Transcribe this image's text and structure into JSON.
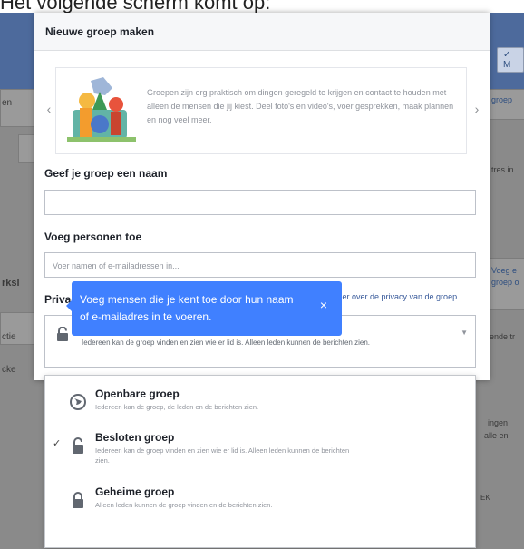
{
  "caption": "Het volgende scherm komt op:",
  "modal": {
    "title": "Nieuwe groep maken"
  },
  "promo": {
    "text": "Groepen zijn erg praktisch om dingen geregeld te krijgen en contact te houden met alleen de mensen die jij kiest. Deel foto's en video's, voer gesprekken, maak plannen en nog veel meer."
  },
  "name_section": {
    "label": "Geef je groep een naam",
    "value": ""
  },
  "members_section": {
    "label": "Voeg personen toe",
    "placeholder": "Voer namen of e-mailadressen in..."
  },
  "privacy": {
    "label": "Privacy",
    "link": "Meer over de privacy van de groep",
    "selected_desc": "Iedereen kan de groep vinden en zien wie er lid is. Alleen leden kunnen de berichten zien."
  },
  "tooltip": {
    "text": "Voeg mensen die je kent toe door hun naam of e-mailadres in te voeren.",
    "close": "×"
  },
  "options": [
    {
      "title": "Openbare groep",
      "desc": "Iedereen kan de groep, de leden en de berichten zien.",
      "icon": "globe-icon",
      "selected": false
    },
    {
      "title": "Besloten groep",
      "desc": "Iedereen kan de groep vinden en zien wie er lid is. Alleen leden kunnen de berichten zien.",
      "icon": "unlock-icon",
      "selected": true
    },
    {
      "title": "Geheime groep",
      "desc": "Alleen leden kunnen de groep vinden en de berichten zien.",
      "icon": "lock-icon",
      "selected": false
    }
  ],
  "background": {
    "left_fragments": [
      "en",
      "rksl",
      "ctie",
      "cke"
    ],
    "right_fragments": [
      "groep",
      "tres in",
      "Voeg e",
      "groep o",
      "ende tr",
      "ingen",
      "alle en",
      "EK"
    ],
    "top_button": "✓ M"
  },
  "colors": {
    "accent": "#4080ff",
    "header_blue": "#4d6a9c",
    "link": "#365899"
  }
}
